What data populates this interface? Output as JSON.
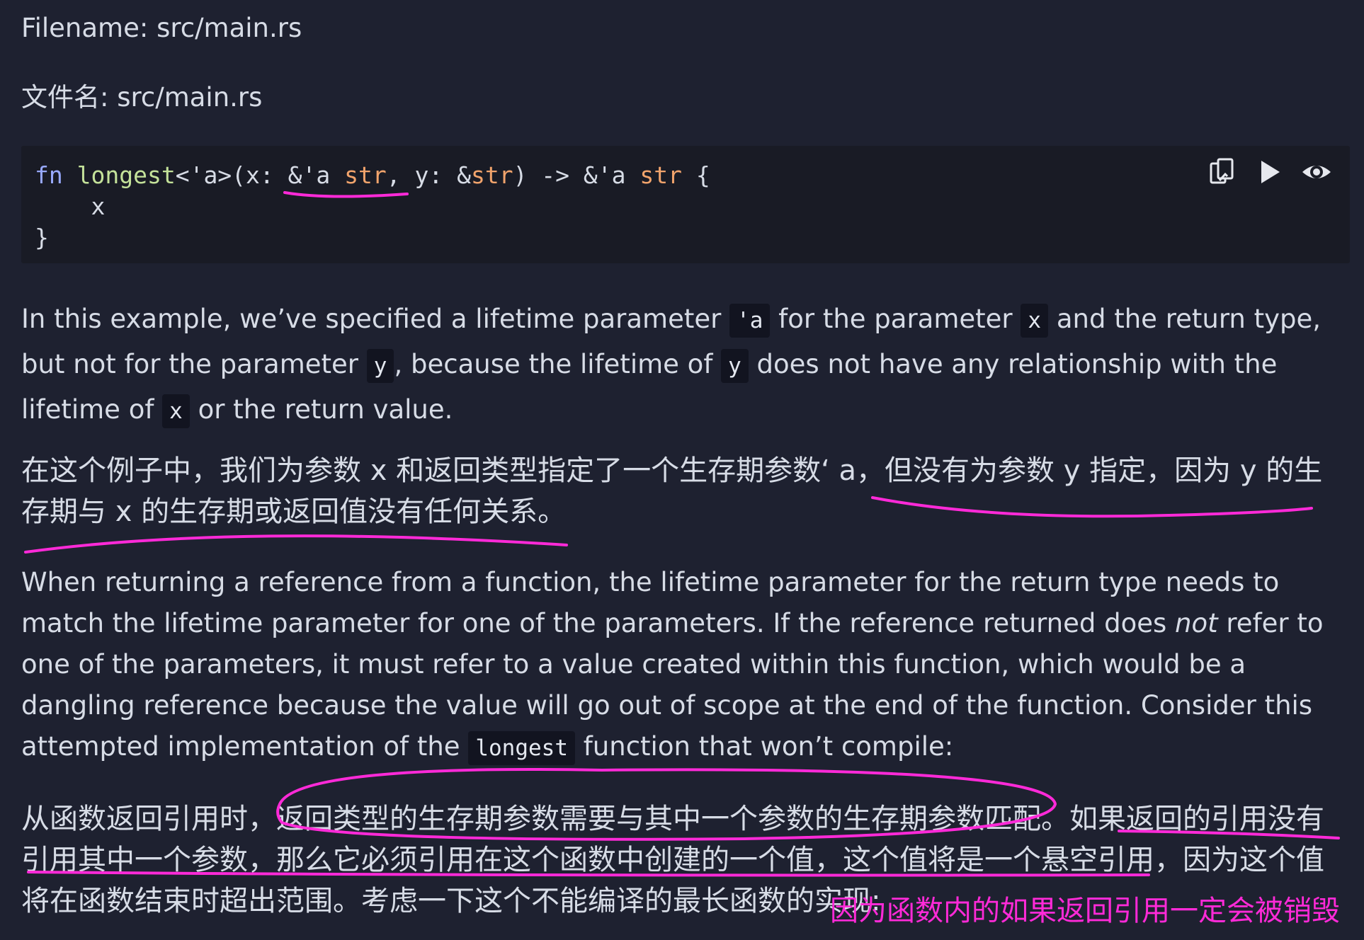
{
  "filename": {
    "en": "Filename: src/main.rs",
    "zh": "文件名: src/main.rs"
  },
  "code": {
    "line1": {
      "kw": "fn",
      "name": "longest",
      "a": "<'a>(x: &'a ",
      "ty1": "str",
      "b": ", y: &",
      "ty2": "str",
      "c": ") -> &'a ",
      "ty3": "str",
      "d": " {"
    },
    "line2": "    x",
    "line3": "}",
    "tools": [
      "copy-icon",
      "play-icon",
      "eye-icon"
    ]
  },
  "para_en_1": {
    "t1": "In this example, we’ve specified a lifetime parameter ",
    "c1": "'a",
    "t2": " for the parameter ",
    "c2": "x",
    "t3": " and the return type, but not for the parameter ",
    "c3": "y",
    "t4": ", because the lifetime of ",
    "c4": "y",
    "t5": " does not have any relationship with the lifetime of ",
    "c5": "x",
    "t6": " or the return value."
  },
  "para_zh_1": "在这个例子中，我们为参数 x 和返回类型指定了一个生存期参数‘ a，但没有为参数 y 指定，因为 y 的生存期与 x 的生存期或返回值没有任何关系。",
  "para_en_2": {
    "t1": "When returning a reference from a function, the lifetime parameter for the return type needs to match the lifetime parameter for one of the parameters. If the reference returned does ",
    "em": "not",
    "t2": " refer to one of the parameters, it must refer to a value created within this function, which would be a dangling reference because the value will go out of scope at the end of the function. Consider this attempted implementation of the ",
    "c1": "longest",
    "t3": " function that won’t compile:"
  },
  "para_zh_2": "从函数返回引用时，返回类型的生存期参数需要与其中一个参数的生存期参数匹配。如果返回的引用没有引用其中一个参数，那么它必须引用在这个函数中创建的一个值，这个值将是一个悬空引用，因为这个值将在函数结束时超出范围。考虑一下这个不能编译的最长函数的实现:",
  "annotation": "因为函数内的如果返回引用一定会被销毁",
  "colors": {
    "background": "#1e2130",
    "code_bg": "#191b25",
    "annotation": "#ff2ad8"
  }
}
